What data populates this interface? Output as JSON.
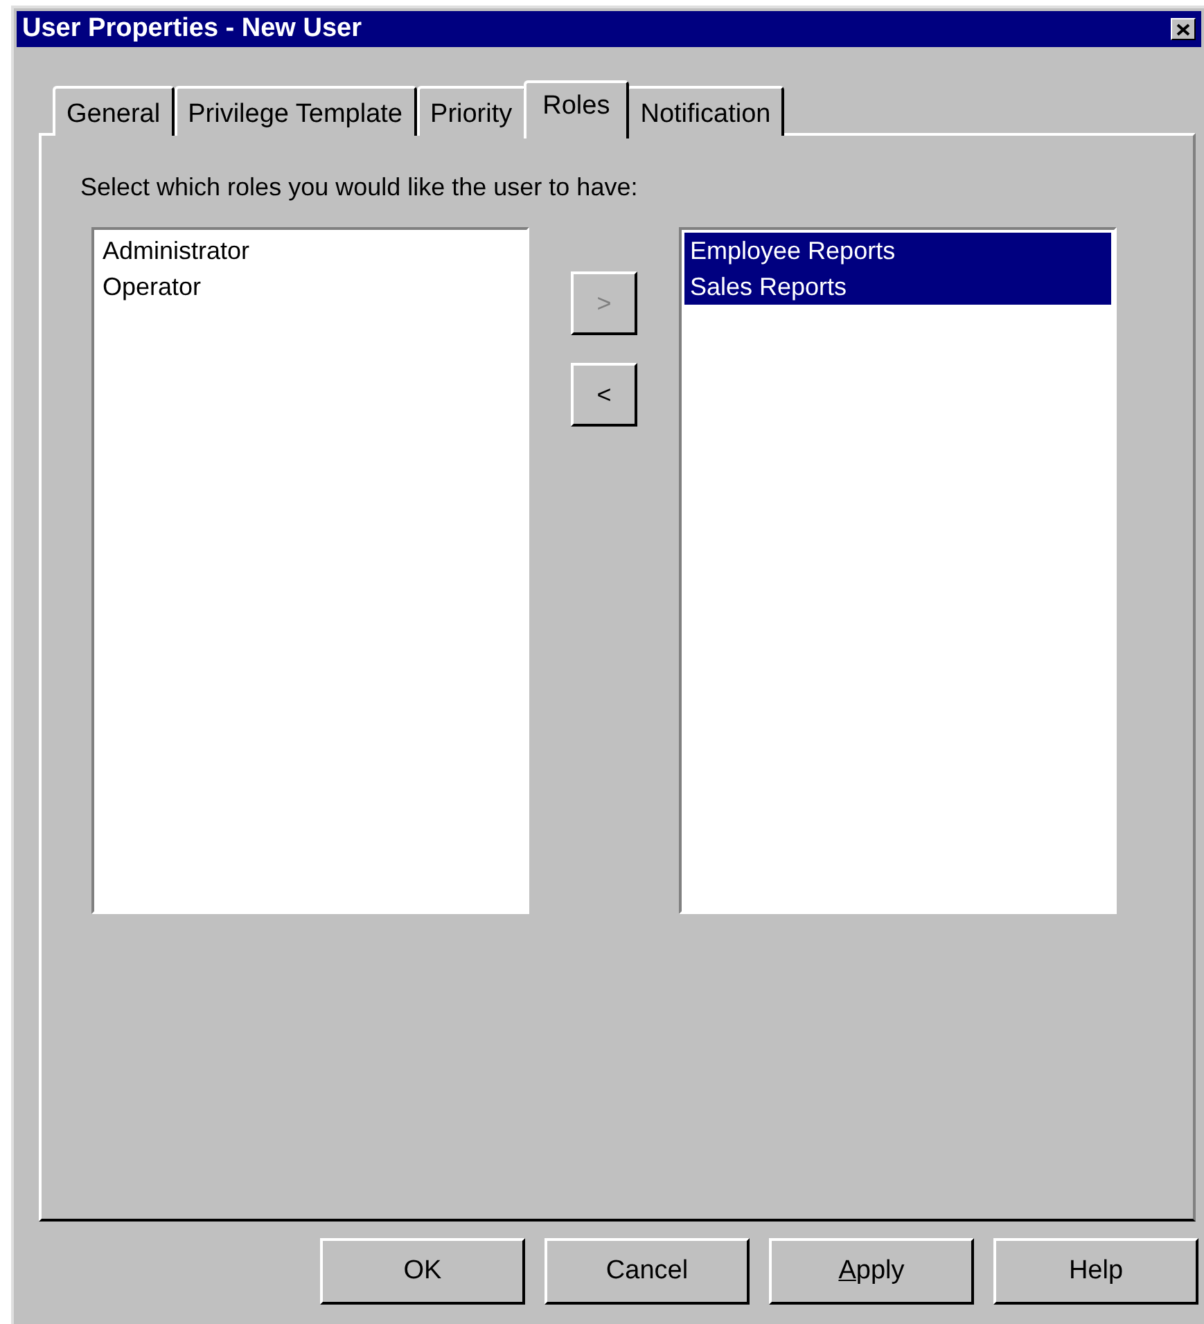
{
  "window": {
    "title": "User Properties - New User"
  },
  "tabs": [
    {
      "label": "General",
      "selected": false
    },
    {
      "label": "Privilege Template",
      "selected": false
    },
    {
      "label": "Priority",
      "selected": false
    },
    {
      "label": "Roles",
      "selected": true
    },
    {
      "label": "Notification",
      "selected": false
    }
  ],
  "instruction": "Select which roles you would like the user to have:",
  "available_roles": [
    {
      "label": "Administrator",
      "selected": false
    },
    {
      "label": "Operator",
      "selected": false
    }
  ],
  "move_buttons": [
    {
      "label": ">",
      "disabled": true
    },
    {
      "label": "<",
      "disabled": false
    }
  ],
  "assigned_roles": [
    {
      "label": "Employee Reports",
      "selected": true
    },
    {
      "label": "Sales Reports",
      "selected": true
    }
  ],
  "buttons": [
    {
      "label": "OK",
      "mnemonic": false
    },
    {
      "label": "Cancel",
      "mnemonic": false
    },
    {
      "label": "Apply",
      "mnemonic": true
    },
    {
      "label": "Help",
      "mnemonic": false
    }
  ]
}
